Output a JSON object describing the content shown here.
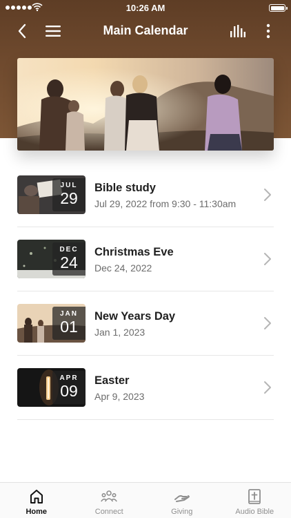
{
  "status_bar": {
    "time": "10:26 AM"
  },
  "header": {
    "title": "Main Calendar"
  },
  "colors": {
    "header_brown": "#6f4a2e",
    "tab_inactive": "#8e8e8e",
    "tab_active": "#111111"
  },
  "events": [
    {
      "month": "JUL",
      "day": "29",
      "title": "Bible study",
      "subtitle": "Jul 29, 2022 from 9:30 - 11:30am"
    },
    {
      "month": "DEC",
      "day": "24",
      "title": "Christmas Eve",
      "subtitle": "Dec 24, 2022"
    },
    {
      "month": "JAN",
      "day": "01",
      "title": "New Years Day",
      "subtitle": "Jan 1, 2023"
    },
    {
      "month": "APR",
      "day": "09",
      "title": "Easter",
      "subtitle": "Apr 9, 2023"
    }
  ],
  "tabs": [
    {
      "label": "Home",
      "icon": "home-icon",
      "active": true
    },
    {
      "label": "Connect",
      "icon": "group-icon",
      "active": false
    },
    {
      "label": "Giving",
      "icon": "giving-hand-icon",
      "active": false
    },
    {
      "label": "Audio Bible",
      "icon": "bible-icon",
      "active": false
    }
  ]
}
